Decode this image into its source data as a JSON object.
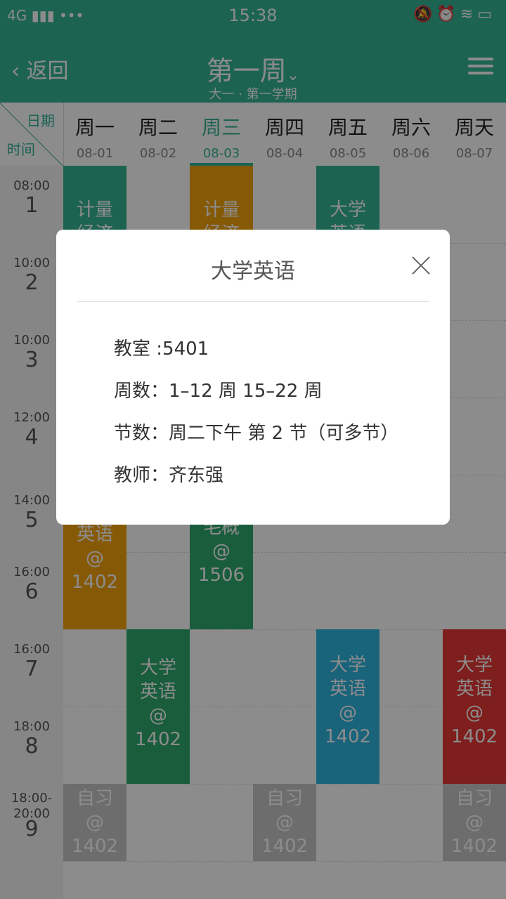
{
  "status": {
    "network": "4G",
    "time": "15:38"
  },
  "appbar": {
    "back_label": "返回",
    "week_title": "第一周",
    "semester": "大一 · 第一学期"
  },
  "header": {
    "corner_date": "日期",
    "corner_time": "时间",
    "days": [
      {
        "name": "周一",
        "date": "08-01"
      },
      {
        "name": "周二",
        "date": "08-02"
      },
      {
        "name": "周三",
        "date": "08-03"
      },
      {
        "name": "周四",
        "date": "08-04"
      },
      {
        "name": "周五",
        "date": "08-05"
      },
      {
        "name": "周六",
        "date": "08-06"
      },
      {
        "name": "周天",
        "date": "08-07"
      }
    ]
  },
  "slots": [
    {
      "time": "08:00",
      "num": "1"
    },
    {
      "time": "10:00",
      "num": "2"
    },
    {
      "time": "10:00",
      "num": "3"
    },
    {
      "time": "12:00",
      "num": "4"
    },
    {
      "time": "14:00",
      "num": "5"
    },
    {
      "time": "16:00",
      "num": "6"
    },
    {
      "time": "16:00",
      "num": "7"
    },
    {
      "time": "18:00",
      "num": "8"
    },
    {
      "time": "18:00-\n20:00",
      "num": "9"
    }
  ],
  "courses": [
    {
      "text": "计量\n经济",
      "color": "#36b596"
    },
    {
      "text": "计量\n经济",
      "color": "#f2a20c"
    },
    {
      "text": "大学\n英语",
      "color": "#36b596"
    },
    {
      "text": "英语\n@\n1402",
      "color": "#f2a20c"
    },
    {
      "text": "毛概\n@\n1506",
      "color": "#2eaa6e"
    },
    {
      "text": "大学\n英语\n@\n1402",
      "color": "#2eaa6e"
    },
    {
      "text": "大学\n英语\n@\n1402",
      "color": "#2eb5e0"
    },
    {
      "text": "大学\n英语\n@\n1402",
      "color": "#e53935"
    },
    {
      "text": "自习\n@\n1402",
      "color": "#c7c7c7"
    },
    {
      "text": "自习\n@\n1402",
      "color": "#c7c7c7"
    },
    {
      "text": "自习\n@\n1402",
      "color": "#c7c7c7"
    }
  ],
  "dialog": {
    "title": "大学英语",
    "room": "教室 :5401",
    "weeks": "周数：1–12 周   15–22 周",
    "sessions": "节数：周二下午  第 2 节（可多节）",
    "teacher": "教师：齐东强"
  }
}
